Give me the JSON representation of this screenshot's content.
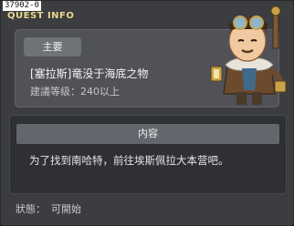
{
  "window": {
    "quest_id": "37902-0",
    "title": "QUEST INFO"
  },
  "summary": {
    "badge": "主要",
    "quest_name": "[塞拉斯]竜没于海底之物",
    "level_requirement": "建議等级：240以上"
  },
  "details": {
    "header": "内容",
    "description": "为了找到南哈特，前往埃斯佩拉大本营吧。"
  },
  "status": {
    "label": "狀態：",
    "value": "可開始"
  },
  "npc": {
    "icon": "npc-explorer-portrait"
  },
  "colors": {
    "accent_title": "#e9d88a",
    "panel": "#505257",
    "panel_dark": "#2f3034"
  }
}
